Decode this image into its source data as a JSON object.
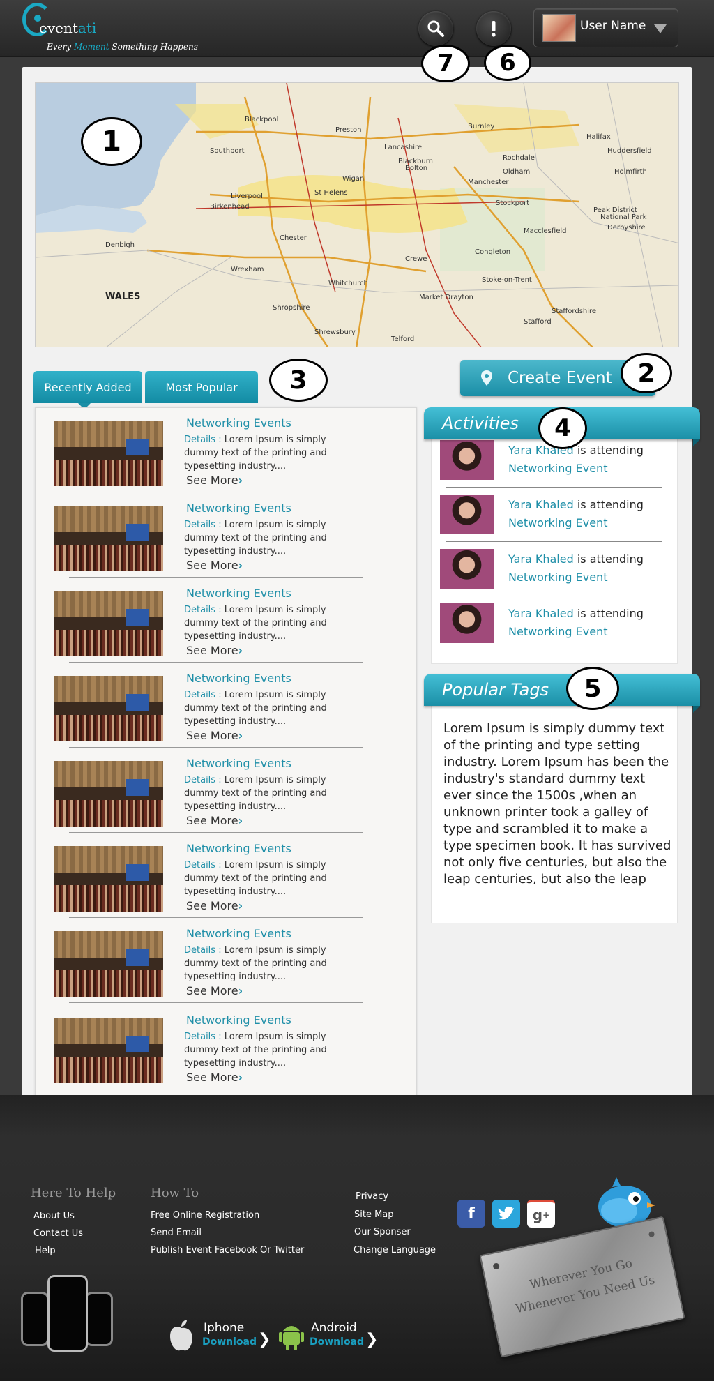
{
  "header": {
    "logo_word_main": "event",
    "logo_word_accent": "ati",
    "tagline_before": "Every ",
    "tagline_accent": "Moment",
    "tagline_after": " Something Happens",
    "user_name": "User Name"
  },
  "callouts": [
    "1",
    "2",
    "3",
    "4",
    "5",
    "6",
    "7"
  ],
  "map": {
    "region_label_wales": "WALES",
    "places": [
      "Preston",
      "Lancashire",
      "Burnley",
      "Blackpool",
      "Southport",
      "Blackburn",
      "Bolton",
      "Oldham",
      "Manchester",
      "St Helens",
      "Wigan",
      "Liverpool",
      "Stockport",
      "Chester",
      "Derbyshire",
      "Peak District National Park",
      "Stoke-on-Trent",
      "Shropshire",
      "Staffordshire",
      "Shrewsbury",
      "Stafford",
      "Telford",
      "Crewe",
      "Macclesfield",
      "Huddersfield",
      "Halifax",
      "Rochdale",
      "Birkenhead",
      "Wrexham",
      "Denbigh",
      "Congleton",
      "Whitchurch",
      "Market Drayton",
      "Holmfirth"
    ]
  },
  "create_event_label": "Create Event",
  "tabs": [
    {
      "label": "Recently Added"
    },
    {
      "label": "Most Popular"
    }
  ],
  "events": [
    {
      "title": "Networking Events",
      "details_label": "Details :",
      "description": "Lorem Ipsum is simply dummy text of the printing and typesetting industry....",
      "more": "See More"
    },
    {
      "title": "Networking Events",
      "details_label": "Details :",
      "description": "Lorem Ipsum is simply dummy text of the printing and typesetting industry....",
      "more": "See More"
    },
    {
      "title": "Networking Events",
      "details_label": "Details :",
      "description": "Lorem Ipsum is simply dummy text of the printing and typesetting industry....",
      "more": "See More"
    },
    {
      "title": "Networking Events",
      "details_label": "Details :",
      "description": "Lorem Ipsum is simply dummy text of the printing and typesetting industry....",
      "more": "See More"
    },
    {
      "title": "Networking Events",
      "details_label": "Details :",
      "description": "Lorem Ipsum is simply dummy text of the printing and typesetting industry....",
      "more": "See More"
    },
    {
      "title": "Networking Events",
      "details_label": "Details :",
      "description": "Lorem Ipsum is simply dummy text of the printing and typesetting industry....",
      "more": "See More"
    },
    {
      "title": "Networking Events",
      "details_label": "Details :",
      "description": "Lorem Ipsum is simply dummy text of the printing and typesetting industry....",
      "more": "See More"
    },
    {
      "title": "Networking Events",
      "details_label": "Details :",
      "description": "Lorem Ipsum is simply dummy text of the printing and typesetting industry....",
      "more": "See More"
    }
  ],
  "activities": {
    "title": "Activities",
    "items": [
      {
        "name": "Yara Khaled",
        "verb": " is attending",
        "event": "Networking Event"
      },
      {
        "name": "Yara Khaled",
        "verb": " is attending",
        "event": "Networking Event"
      },
      {
        "name": "Yara Khaled",
        "verb": " is attending",
        "event": "Networking Event"
      },
      {
        "name": "Yara Khaled",
        "verb": " is attending",
        "event": "Networking Event"
      }
    ]
  },
  "popular_tags": {
    "title": "Popular Tags",
    "text": "Lorem Ipsum is simply dummy text of the printing and type setting industry. Lorem Ipsum has been the industry's standard dummy text ever since the 1500s ,when an unknown printer took a galley of type and scrambled it to make a type specimen book. It has survived not only five centuries, but also the leap centuries, but also the leap"
  },
  "footer": {
    "col1": {
      "heading": "Here To Help",
      "links": [
        "About Us",
        "Contact Us",
        "Help"
      ]
    },
    "col2": {
      "heading": "How To",
      "links": [
        "Free Online Registration",
        "Send Email",
        "Publish Event Facebook Or Twitter"
      ]
    },
    "col3": {
      "links": [
        "Privacy",
        "Site Map",
        "Our Sponser",
        "Change Language"
      ]
    },
    "plaque_line1": "Wherever You Go",
    "plaque_line2": "Whenever You Need Us",
    "apps": [
      {
        "name": "Iphone",
        "download": "Download"
      },
      {
        "name": "Android",
        "download": "Download"
      }
    ]
  },
  "colors": {
    "accent": "#1f8fa8",
    "header_bg": "#2f2f2f",
    "panel_bg": "#f1f1f1"
  }
}
